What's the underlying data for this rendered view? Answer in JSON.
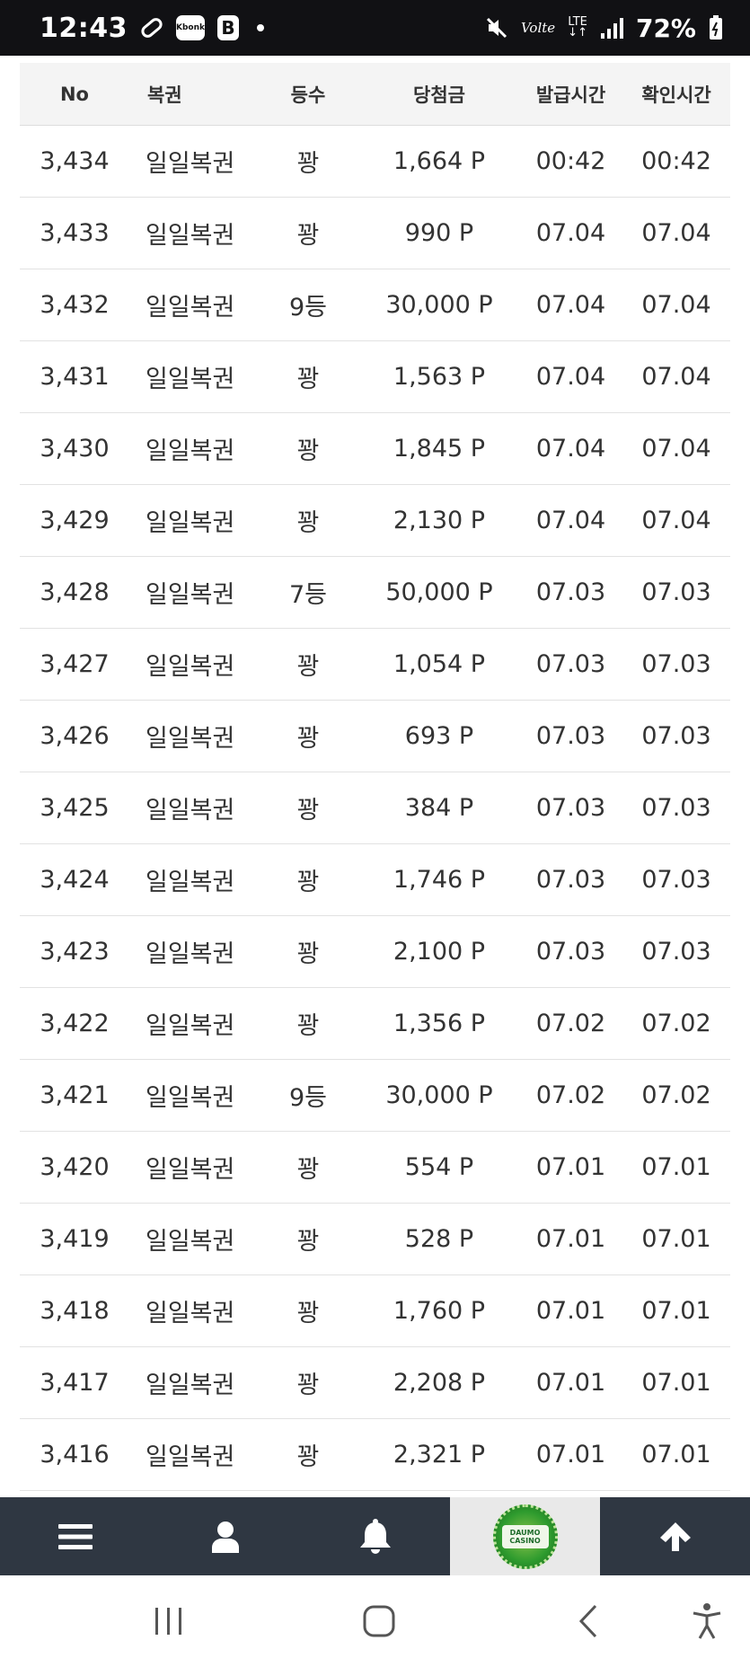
{
  "status_bar": {
    "time": "12:43",
    "kbank_label": "Kbonk",
    "b_label": "B",
    "volte_label": "Volte",
    "lte_label": "LTE",
    "battery_pct": "72%"
  },
  "table": {
    "headers": {
      "no": "No",
      "type": "복권",
      "rank": "등수",
      "prize": "당첨금",
      "issue_time": "발급시간",
      "check_time": "확인시간"
    },
    "rows": [
      {
        "no": "3,434",
        "type": "일일복권",
        "rank": "꽝",
        "prize": "1,664 P",
        "issue": "00:42",
        "check": "00:42"
      },
      {
        "no": "3,433",
        "type": "일일복권",
        "rank": "꽝",
        "prize": "990 P",
        "issue": "07.04",
        "check": "07.04"
      },
      {
        "no": "3,432",
        "type": "일일복권",
        "rank": "9등",
        "prize": "30,000 P",
        "issue": "07.04",
        "check": "07.04"
      },
      {
        "no": "3,431",
        "type": "일일복권",
        "rank": "꽝",
        "prize": "1,563 P",
        "issue": "07.04",
        "check": "07.04"
      },
      {
        "no": "3,430",
        "type": "일일복권",
        "rank": "꽝",
        "prize": "1,845 P",
        "issue": "07.04",
        "check": "07.04"
      },
      {
        "no": "3,429",
        "type": "일일복권",
        "rank": "꽝",
        "prize": "2,130 P",
        "issue": "07.04",
        "check": "07.04"
      },
      {
        "no": "3,428",
        "type": "일일복권",
        "rank": "7등",
        "prize": "50,000 P",
        "issue": "07.03",
        "check": "07.03"
      },
      {
        "no": "3,427",
        "type": "일일복권",
        "rank": "꽝",
        "prize": "1,054 P",
        "issue": "07.03",
        "check": "07.03"
      },
      {
        "no": "3,426",
        "type": "일일복권",
        "rank": "꽝",
        "prize": "693 P",
        "issue": "07.03",
        "check": "07.03"
      },
      {
        "no": "3,425",
        "type": "일일복권",
        "rank": "꽝",
        "prize": "384 P",
        "issue": "07.03",
        "check": "07.03"
      },
      {
        "no": "3,424",
        "type": "일일복권",
        "rank": "꽝",
        "prize": "1,746 P",
        "issue": "07.03",
        "check": "07.03"
      },
      {
        "no": "3,423",
        "type": "일일복권",
        "rank": "꽝",
        "prize": "2,100 P",
        "issue": "07.03",
        "check": "07.03"
      },
      {
        "no": "3,422",
        "type": "일일복권",
        "rank": "꽝",
        "prize": "1,356 P",
        "issue": "07.02",
        "check": "07.02"
      },
      {
        "no": "3,421",
        "type": "일일복권",
        "rank": "9등",
        "prize": "30,000 P",
        "issue": "07.02",
        "check": "07.02"
      },
      {
        "no": "3,420",
        "type": "일일복권",
        "rank": "꽝",
        "prize": "554 P",
        "issue": "07.01",
        "check": "07.01"
      },
      {
        "no": "3,419",
        "type": "일일복권",
        "rank": "꽝",
        "prize": "528 P",
        "issue": "07.01",
        "check": "07.01"
      },
      {
        "no": "3,418",
        "type": "일일복권",
        "rank": "꽝",
        "prize": "1,760 P",
        "issue": "07.01",
        "check": "07.01"
      },
      {
        "no": "3,417",
        "type": "일일복권",
        "rank": "꽝",
        "prize": "2,208 P",
        "issue": "07.01",
        "check": "07.01"
      },
      {
        "no": "3,416",
        "type": "일일복권",
        "rank": "꽝",
        "prize": "2,321 P",
        "issue": "07.01",
        "check": "07.01"
      }
    ]
  },
  "app_nav": {
    "items": [
      "hamburger-menu-icon",
      "user-icon",
      "bell-icon",
      "daumo-casino-logo",
      "arrow-up-icon"
    ],
    "logo_line1": "DAUMO",
    "logo_line2": "CASINO"
  },
  "colors": {
    "status_bg": "#111114",
    "header_bg": "#f4f4f4",
    "nav_bg": "#2f3742",
    "nav_logo_bg": "#e9e9e9",
    "logo_green": "#2e9b2e"
  }
}
